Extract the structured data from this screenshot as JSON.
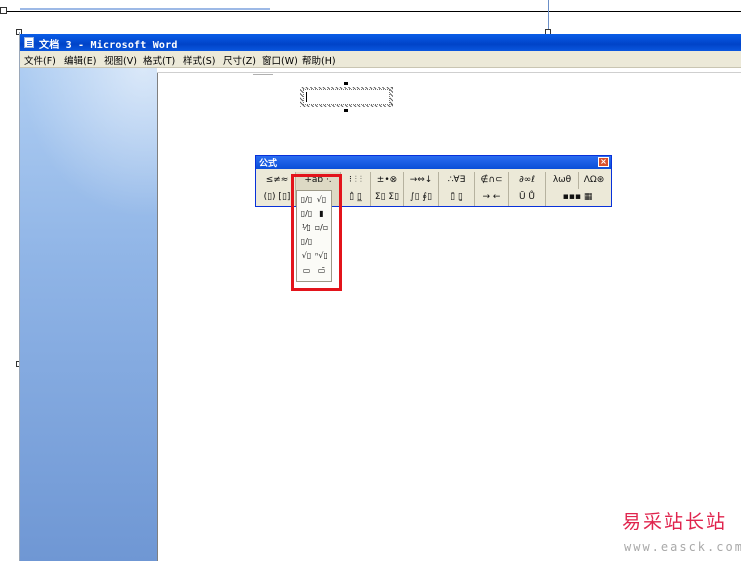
{
  "window": {
    "title": "文档 3 - Microsoft Word"
  },
  "menubar": {
    "items": [
      "文件(F)",
      "编辑(E)",
      "视图(V)",
      "格式(T)",
      "样式(S)",
      "尺寸(Z)",
      "窗口(W)",
      "帮助(H)"
    ]
  },
  "formula_toolbar": {
    "title": "公式",
    "close_glyph": "×",
    "row1": [
      "≤≠≈",
      "∔ab ·.",
      "⁝ ⫶ ⫶",
      "±•⊗",
      "→⇔↓",
      "∴∀∃",
      "∉∩⊂",
      "∂∞ℓ",
      "λωθ",
      "ΛΩ⊛"
    ],
    "row2": [
      "(▯) [▯]",
      "▯/▯ √▯",
      "▯̂ ▯̲",
      "Σ▯ Σ▯",
      "∫▯ ∮▯",
      "▯̄ ▯̱",
      "→ ←",
      "Ū Ů",
      "▪▪▪ ▦"
    ]
  },
  "template_palette": {
    "cells": [
      "▯/▯",
      "√▯",
      "▯/▯",
      "▮",
      "⅟▯",
      "▫/▫",
      "▯/▯",
      "",
      "√▯",
      "ⁿ√▯",
      "▭",
      "▭̄"
    ]
  },
  "watermark": {
    "title": "易采站长站",
    "url": "www.easck.com"
  },
  "colors": {
    "titlebar": "#0043c8",
    "highlight": "#e3141b",
    "watermark_red": "#e0244d"
  }
}
